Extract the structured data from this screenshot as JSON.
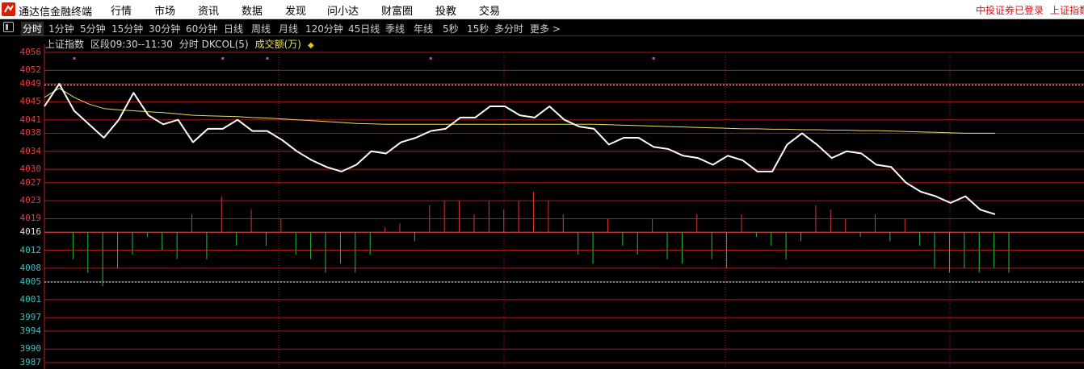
{
  "app": {
    "title": "通达信金融终端",
    "menu": [
      "行情",
      "市场",
      "资讯",
      "数据",
      "发现",
      "问小达",
      "财富圈",
      "投教",
      "交易"
    ],
    "status": [
      "中投证券已登录",
      "上证指数"
    ]
  },
  "periods": {
    "items": [
      "分时",
      "1分钟",
      "5分钟",
      "15分钟",
      "30分钟",
      "60分钟",
      "日线",
      "周线",
      "月线",
      "120分钟",
      "45日线",
      "季线",
      "年线",
      "5秒",
      "15秒",
      "多分时",
      "更多 >"
    ],
    "active": "分时"
  },
  "chart_header": {
    "index_name": "上证指数",
    "range": "区段09:30--11:30",
    "indicator": "分时 DKCOL(5)",
    "volume_label": "成交额(万)",
    "arrow": "◆"
  },
  "chart_data": {
    "type": "line",
    "y_ticks": [
      "4056",
      "4052",
      "4049",
      "4045",
      "4041",
      "4038",
      "4034",
      "4030",
      "4027",
      "4023",
      "4019",
      "4016",
      "4012",
      "4008",
      "4005",
      "4001",
      "3997",
      "3994",
      "3990",
      "3987"
    ],
    "ylim": [
      3987,
      4056
    ],
    "baseline": 4016,
    "grid": true,
    "time_range": [
      "09:30",
      "11:30"
    ],
    "series": [
      {
        "values": [
          4044,
          4049,
          4043,
          4040,
          4037,
          4041,
          4047,
          4042,
          4040,
          4041,
          4036,
          4039,
          4039,
          4041,
          4038.5,
          4038.5,
          4036.5,
          4034,
          4032,
          4030.5,
          4029.5,
          4031,
          4034,
          4033.5,
          4036,
          4037,
          4038.5,
          4039,
          4041.5,
          4041.5,
          4044,
          4044,
          4042,
          4041.5,
          4044,
          4041,
          4039.5,
          4039,
          4035.5,
          4037,
          4037,
          4035,
          4034.5,
          4033,
          4032.5,
          4031,
          4033,
          4032,
          4029.5,
          4029.5,
          4035.5,
          4038,
          4035.5,
          4032.5,
          4034,
          4033.5,
          4031,
          4030.5,
          4027,
          4025,
          4024,
          4022.5,
          4024,
          4021,
          4020
        ]
      },
      {
        "values": [
          4046,
          4048,
          4046,
          4044.5,
          4043.5,
          4043.2,
          4043,
          4042.8,
          4042.6,
          4042.3,
          4042,
          4041.9,
          4041.8,
          4041.7,
          4041.5,
          4041.4,
          4041.2,
          4041,
          4040.8,
          4040.6,
          4040.4,
          4040.2,
          4040.1,
          4040,
          4040,
          4040,
          4040,
          4040,
          4040,
          4040,
          4040,
          4040,
          4040,
          4040,
          4040,
          4040,
          4040,
          4040,
          4039.9,
          4039.8,
          4039.7,
          4039.6,
          4039.5,
          4039.4,
          4039.3,
          4039.2,
          4039.1,
          4039,
          4039,
          4038.9,
          4038.9,
          4038.8,
          4038.8,
          4038.7,
          4038.7,
          4038.6,
          4038.6,
          4038.5,
          4038.4,
          4038.3,
          4038.2,
          4038.1,
          4038,
          4038,
          4038
        ]
      }
    ],
    "bars": [
      4016,
      4010,
      4007,
      4004,
      4008,
      4011,
      4015,
      4012,
      4010,
      4020,
      4010,
      4024,
      4013,
      4021,
      4013,
      4019,
      4011,
      4010,
      4007,
      4009,
      4007,
      4011,
      4017,
      4018,
      4014,
      4022,
      4023,
      4023,
      4020,
      4023,
      4021,
      4023,
      4025,
      4023,
      4020,
      4011,
      4009,
      4019,
      4013,
      4011,
      4019,
      4010,
      4009,
      4020,
      4010,
      4008,
      4020,
      4015,
      4013,
      4010,
      4014,
      4022,
      4021,
      4019,
      4015,
      4020,
      4014,
      4019,
      4013,
      4008,
      4007,
      4008,
      4007,
      4008,
      4007
    ],
    "marks": [
      1,
      11,
      14,
      25,
      40
    ]
  },
  "colors": {
    "price_line": "#ffffff",
    "avg_line": "#e8e060",
    "up_bar": "#e03030",
    "down_bar": "#20c040",
    "grid": "#b01818",
    "mark": "#e030e0"
  }
}
